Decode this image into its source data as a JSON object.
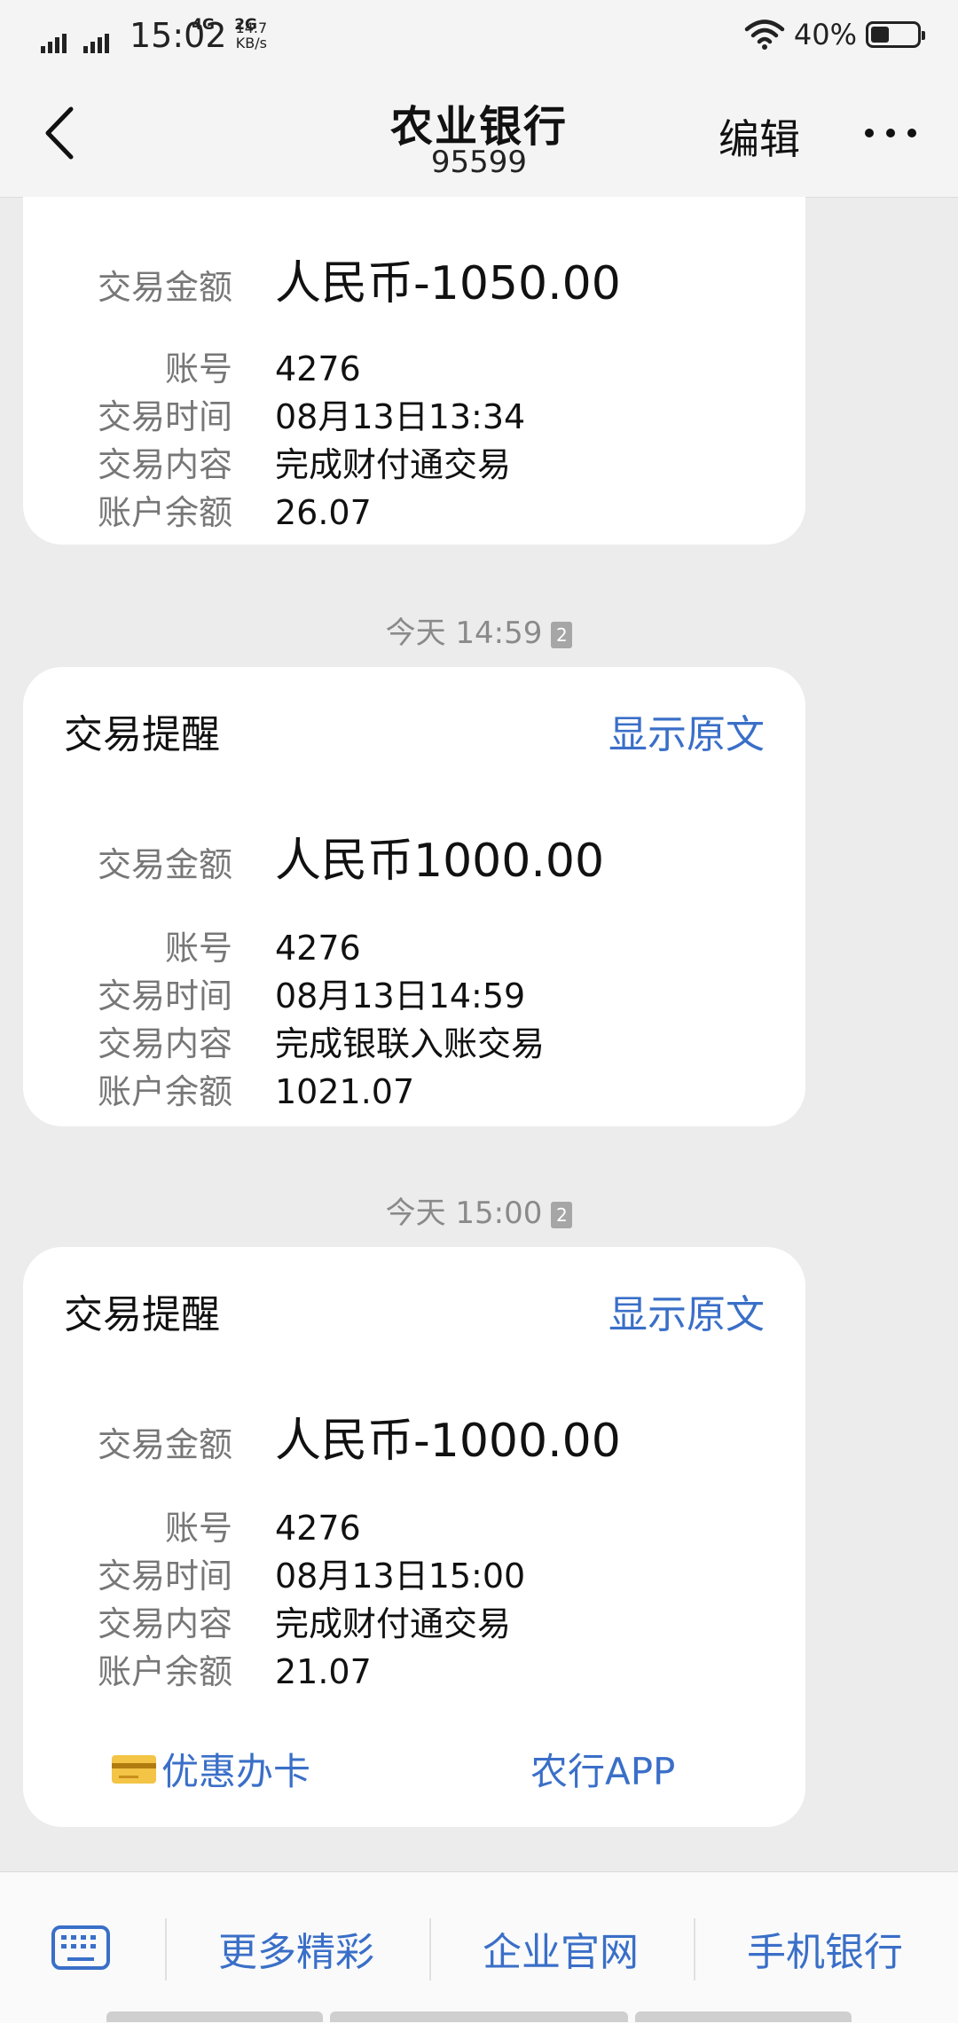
{
  "status_bar": {
    "network_1": "4G",
    "network_2": "2G",
    "time": "15:02",
    "speed_value": "14.7",
    "speed_unit": "KB/s",
    "battery": "40%",
    "battery_level": 0.4
  },
  "header": {
    "title": "农业银行",
    "subtitle": "95599",
    "edit_label": "编辑"
  },
  "messages": [
    {
      "amount_label": "交易金额",
      "amount": "人民币-1050.00",
      "fields": [
        {
          "label": "账号",
          "value": "4276"
        },
        {
          "label": "交易时间",
          "value": "08月13日13:34"
        },
        {
          "label": "交易内容",
          "value": "完成财付通交易"
        },
        {
          "label": "账户余额",
          "value": "26.07"
        }
      ]
    },
    {
      "timestamp": "今天 14:59",
      "sim": "2",
      "heading": "交易提醒",
      "show_original": "显示原文",
      "amount_label": "交易金额",
      "amount": "人民币1000.00",
      "fields": [
        {
          "label": "账号",
          "value": "4276"
        },
        {
          "label": "交易时间",
          "value": "08月13日14:59"
        },
        {
          "label": "交易内容",
          "value": "完成银联入账交易"
        },
        {
          "label": "账户余额",
          "value": "1021.07"
        }
      ]
    },
    {
      "timestamp": "今天 15:00",
      "sim": "2",
      "heading": "交易提醒",
      "show_original": "显示原文",
      "amount_label": "交易金额",
      "amount": "人民币-1000.00",
      "fields": [
        {
          "label": "账号",
          "value": "4276"
        },
        {
          "label": "交易时间",
          "value": "08月13日15:00"
        },
        {
          "label": "交易内容",
          "value": "完成财付通交易"
        },
        {
          "label": "账户余额",
          "value": "21.07"
        }
      ],
      "links": {
        "card": "优惠办卡",
        "app": "农行APP"
      }
    }
  ],
  "bottom_menu": {
    "items": [
      "更多精彩",
      "企业官网",
      "手机银行"
    ]
  },
  "colors": {
    "accent": "#3a6fc8",
    "background": "#ececec"
  }
}
